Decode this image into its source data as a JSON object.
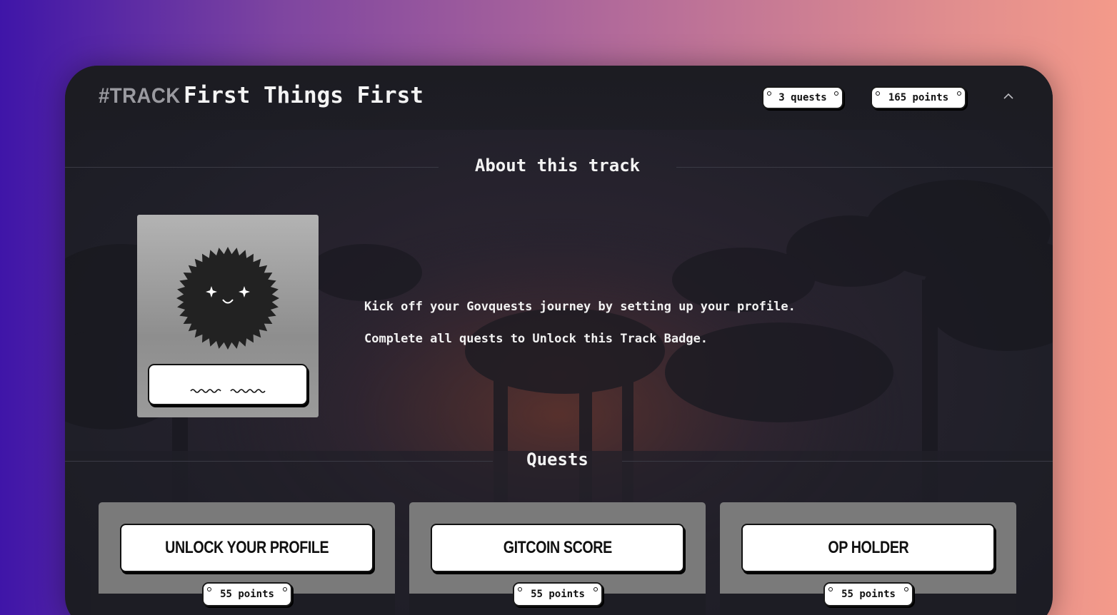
{
  "track": {
    "tag": "#TRACK",
    "title": "First Things First",
    "quests_pill": "3 quests",
    "points_pill": "165 points"
  },
  "about": {
    "heading": "About this track",
    "description_line1": "Kick off your Govquests journey by setting up your profile.",
    "description_line2": "Complete all quests to Unlock this Track Badge."
  },
  "quests": {
    "heading": "Quests",
    "items": [
      {
        "title": "UNLOCK YOUR PROFILE",
        "points": "55 points"
      },
      {
        "title": "GITCOIN SCORE",
        "points": "55 points"
      },
      {
        "title": "OP HOLDER",
        "points": "55 points"
      }
    ]
  },
  "colors": {
    "panel_bg": "#1f1f28",
    "card_gray": "#7a7a7a",
    "pill_bg": "#ffffff",
    "gradient_start": "#3f15a8",
    "gradient_end": "#f49a8a"
  }
}
